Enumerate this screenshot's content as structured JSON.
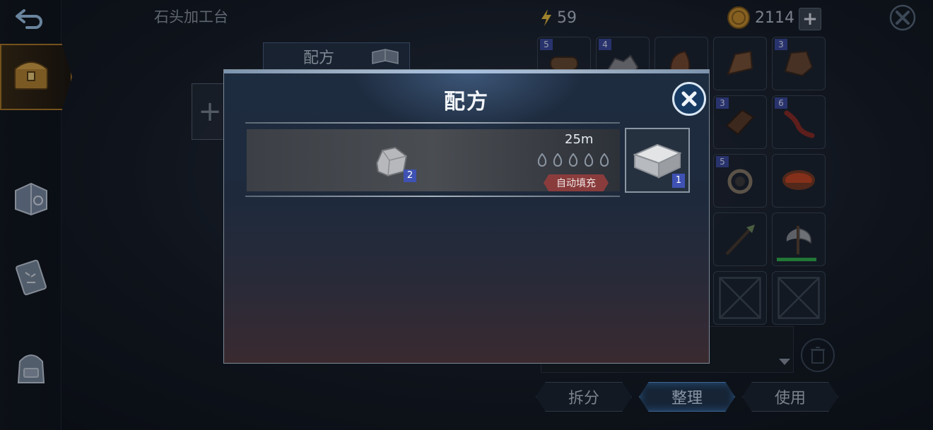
{
  "header": {
    "station_title": "石头加工台",
    "energy": "59",
    "coins": "2114",
    "plus": "+"
  },
  "background": {
    "recipe_tab_label": "配方",
    "add_symbol": "+"
  },
  "inventory": {
    "slots": [
      {
        "count": "5",
        "icon": "log-icon"
      },
      {
        "count": "4",
        "icon": "stone-pile-icon"
      },
      {
        "count": "",
        "icon": "leather-piece-icon"
      },
      {
        "count": "",
        "icon": "wood-bundle-icon"
      },
      {
        "count": "3",
        "icon": "hide-icon"
      },
      {
        "count": "3",
        "icon": "plank-icon"
      },
      {
        "count": "6",
        "icon": "red-fiber-icon"
      },
      {
        "count": "5",
        "icon": "rope-icon"
      },
      {
        "count": "",
        "icon": "soup-bowl-icon"
      },
      {
        "count": "",
        "icon": "spear-icon"
      },
      {
        "count": "",
        "icon": "axe-icon"
      },
      {
        "count": "",
        "icon": "empty-slot-icon"
      },
      {
        "count": "",
        "icon": "empty-slot-icon"
      }
    ]
  },
  "actions": {
    "split": "拆分",
    "sort": "整理",
    "use": "使用"
  },
  "dialog": {
    "title": "配方",
    "recipe": {
      "ingredient_count": "2",
      "time": "25m",
      "autofill": "自动填充",
      "output_count": "1"
    }
  },
  "colors": {
    "count_badge": "#3f52b4",
    "autofill_button": "#8a3c3c",
    "active_tab_border": "#b07a22"
  }
}
